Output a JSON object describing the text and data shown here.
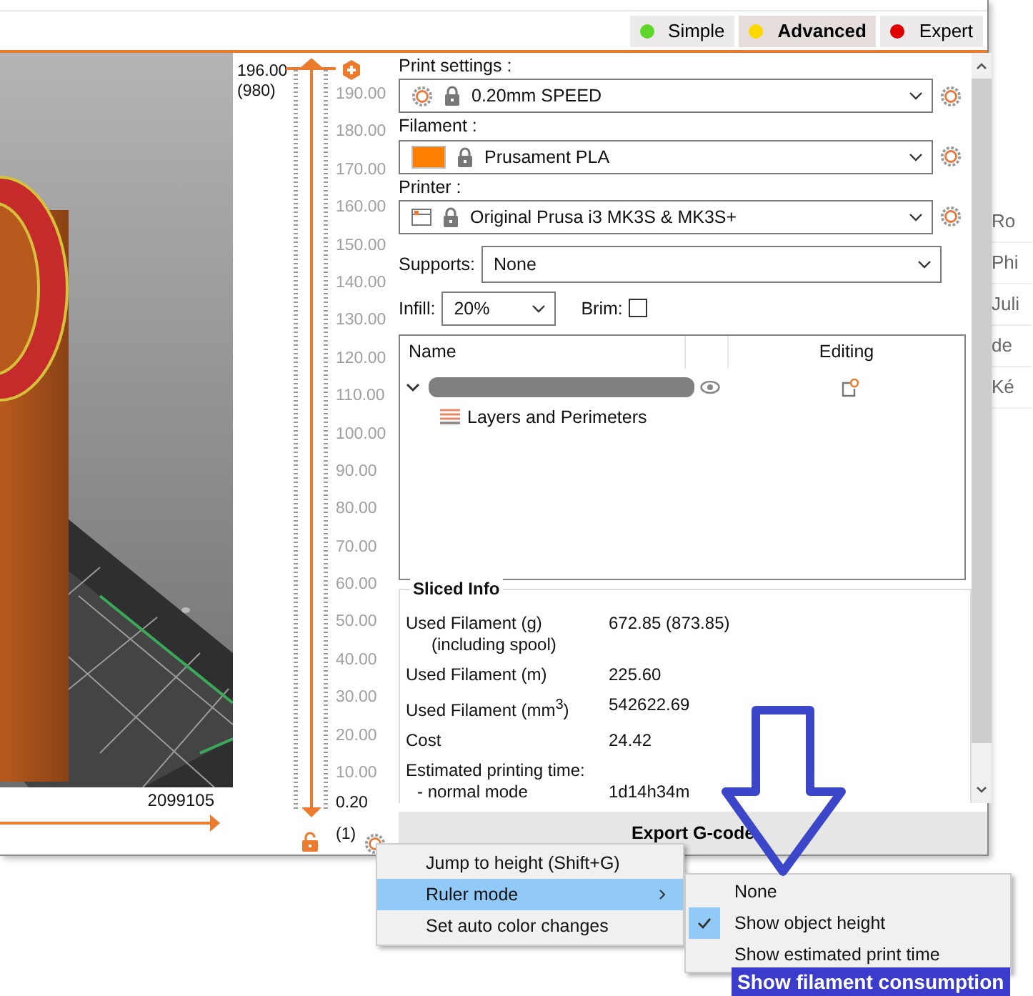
{
  "modes": [
    {
      "label": "Simple",
      "color": "#5ed62a",
      "selected": false
    },
    {
      "label": "Advanced",
      "color": "#ffd800",
      "selected": true
    },
    {
      "label": "Expert",
      "color": "#e00000",
      "selected": false
    }
  ],
  "horizontal_slider": {
    "value": "2099105",
    "level": 1
  },
  "vertical_slider": {
    "level": 1,
    "top_value": "196.00",
    "top_layer": "(980)",
    "ticks": [
      "190.00",
      "180.00",
      "170.00",
      "160.00",
      "150.00",
      "140.00",
      "130.00",
      "120.00",
      "110.00",
      "100.00",
      "90.00",
      "80.00",
      "70.00",
      "60.00",
      "50.00",
      "40.00",
      "30.00",
      "20.00",
      "10.00"
    ],
    "bottom_value": "0.20",
    "bottom_layer": "(1)"
  },
  "presets": [
    {
      "kind": "print",
      "label": "Print settings :",
      "value": "0.20mm SPEED"
    },
    {
      "kind": "filament",
      "label": "Filament :",
      "value": "Prusament PLA"
    },
    {
      "kind": "printer",
      "label": "Printer :",
      "value": "Original Prusa i3 MK3S & MK3S+"
    }
  ],
  "supports": {
    "label": "Supports:",
    "value": "None"
  },
  "infill": {
    "label": "Infill:",
    "value": "20%"
  },
  "brim": {
    "label": "Brim:",
    "checked": false
  },
  "object_list": {
    "columns": [
      "Name",
      "Editing"
    ],
    "rows": [
      {
        "expanded": true,
        "children": [
          {
            "name": "Layers and Perimeters"
          }
        ]
      }
    ]
  },
  "sliced_info": {
    "title": "Sliced Info",
    "rows": [
      {
        "kind": "main",
        "label": "Used Filament (g)",
        "value": "672.85 (873.85)"
      },
      {
        "kind": "sub",
        "label": "(including spool)"
      },
      {
        "kind": "main",
        "label": "Used Filament (m)",
        "value": "225.60"
      },
      {
        "kind": "main",
        "label": "Used Filament (mm$^{3}$)",
        "value": "542622.69"
      },
      {
        "kind": "main",
        "label": "Cost",
        "value": "24.42"
      },
      {
        "kind": "main",
        "label": "Estimated printing time:"
      },
      {
        "kind": "sub",
        "label": "- normal mode",
        "value": "1d14h34m"
      }
    ]
  },
  "export_button": {
    "label": "Export G-code"
  },
  "context_menu": {
    "items": [
      {
        "label": "Jump to height (Shift+G)",
        "selected": false,
        "submenu": false
      },
      {
        "label": "Ruler mode",
        "selected": true,
        "submenu": true
      },
      {
        "label": "Set auto color changes",
        "selected": false,
        "submenu": false
      }
    ]
  },
  "submenu": {
    "items": [
      {
        "label": "None",
        "checked": false
      },
      {
        "label": "Show object height",
        "checked": true
      },
      {
        "label": "Show estimated print time",
        "checked": false
      }
    ]
  },
  "annotation": {
    "label": "Show filament consumption"
  },
  "background_page": {
    "items": [
      "Ro",
      "Phi",
      "Juli",
      "de",
      "Ké"
    ]
  }
}
